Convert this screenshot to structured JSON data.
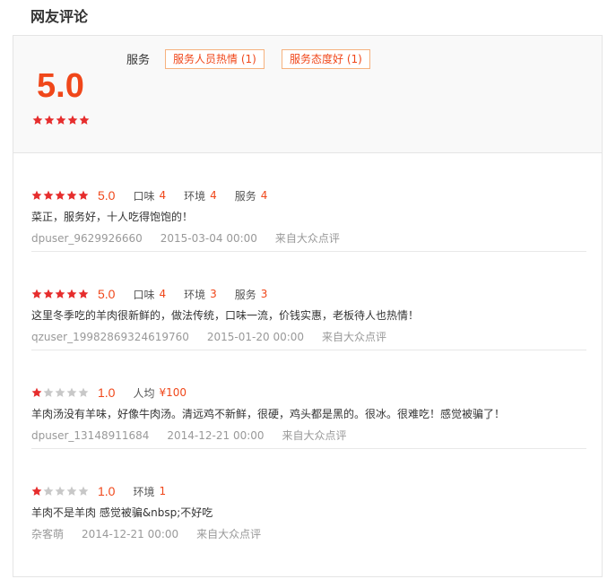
{
  "section_title": "网友评论",
  "summary": {
    "score": "5.0",
    "stars_filled": 5,
    "tag_label": "服务",
    "tags": [
      "服务人员热情 (1)",
      "服务态度好 (1)"
    ]
  },
  "colors": {
    "accent": "#f0471a",
    "star_filled": "#e62d2d",
    "star_empty": "#c8c8c8",
    "tag_border": "#f6b27e"
  },
  "reviews": [
    {
      "stars_filled": 5,
      "score": "5.0",
      "subs": [
        {
          "label": "口味",
          "value": "4"
        },
        {
          "label": "环境",
          "value": "4"
        },
        {
          "label": "服务",
          "value": "4"
        }
      ],
      "comment": "菜正，服务好，十人吃得饱饱的！",
      "user": "dpuser_9629926660",
      "date": "2015-03-04 00:00",
      "source": "来自大众点评"
    },
    {
      "stars_filled": 5,
      "score": "5.0",
      "subs": [
        {
          "label": "口味",
          "value": "4"
        },
        {
          "label": "环境",
          "value": "3"
        },
        {
          "label": "服务",
          "value": "3"
        }
      ],
      "comment": "这里冬季吃的羊肉很新鲜的，做法传统，口味一流，价钱实惠，老板待人也热情！",
      "user": "qzuser_19982869324619760",
      "date": "2015-01-20 00:00",
      "source": "来自大众点评"
    },
    {
      "stars_filled": 1,
      "score": "1.0",
      "subs": [
        {
          "label": "人均",
          "value": "¥100"
        }
      ],
      "comment": "羊肉汤没有羊味，好像牛肉汤。清远鸡不新鲜，很硬，鸡头都是黑的。很冰。很难吃！感觉被骗了！",
      "user": "dpuser_13148911684",
      "date": "2014-12-21 00:00",
      "source": "来自大众点评"
    },
    {
      "stars_filled": 1,
      "score": "1.0",
      "subs": [
        {
          "label": "环境",
          "value": "1"
        }
      ],
      "comment": "羊肉不是羊肉 感觉被骗&nbsp;不好吃",
      "user": "杂客萌",
      "date": "2014-12-21 00:00",
      "source": "来自大众点评"
    }
  ]
}
